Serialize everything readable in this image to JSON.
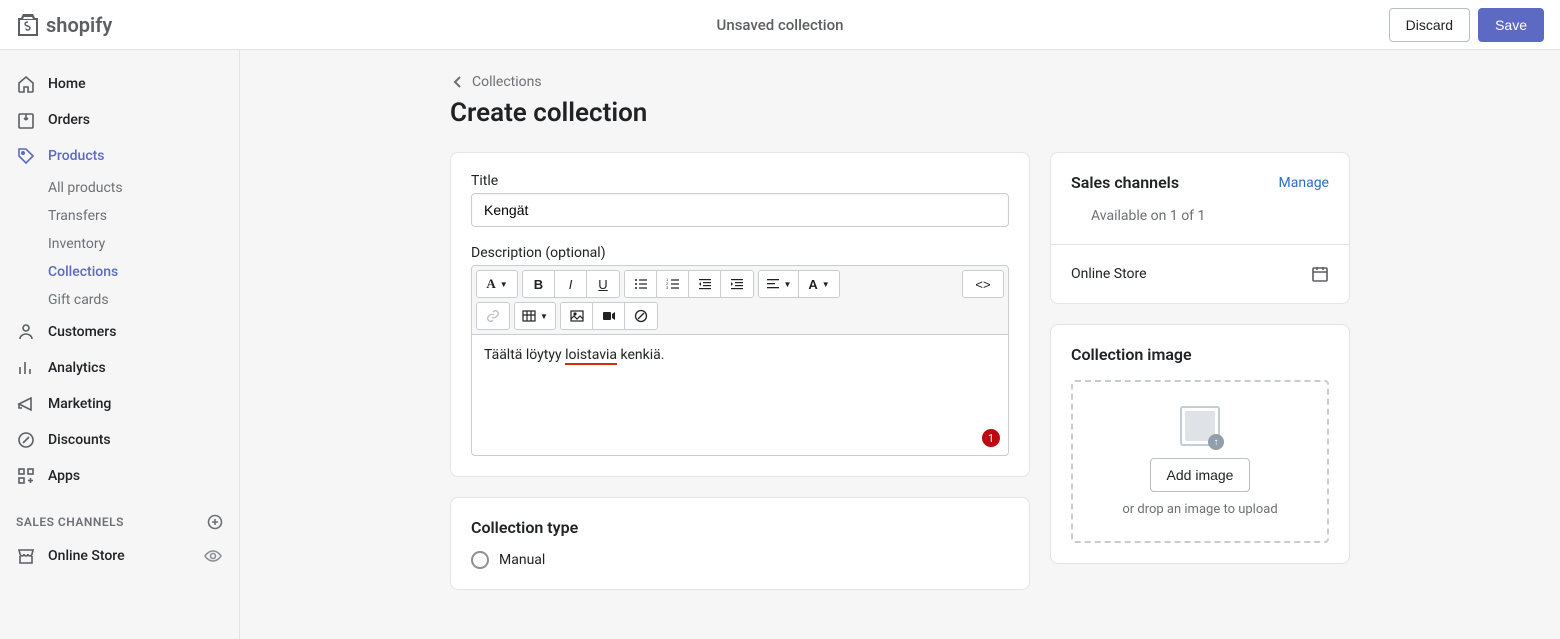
{
  "brand": "shopify",
  "topbar": {
    "title": "Unsaved collection",
    "discard": "Discard",
    "save": "Save"
  },
  "nav": {
    "home": "Home",
    "orders": "Orders",
    "products": "Products",
    "sub": {
      "all_products": "All products",
      "transfers": "Transfers",
      "inventory": "Inventory",
      "collections": "Collections",
      "gift_cards": "Gift cards"
    },
    "customers": "Customers",
    "analytics": "Analytics",
    "marketing": "Marketing",
    "discounts": "Discounts",
    "apps": "Apps",
    "sales_channels_header": "SALES CHANNELS",
    "online_store": "Online Store"
  },
  "breadcrumb": "Collections",
  "page_title": "Create collection",
  "form": {
    "title_label": "Title",
    "title_value": "Kengät",
    "description_label": "Description (optional)",
    "description_prefix": "Täältä löytyy ",
    "description_spell": "loistavia",
    "description_suffix": " kenkiä.",
    "badge_count": "1"
  },
  "collection_type": {
    "heading": "Collection type",
    "option_manual": "Manual"
  },
  "sales_channels": {
    "title": "Sales channels",
    "manage": "Manage",
    "availability": "Available on 1 of 1",
    "online_store": "Online Store"
  },
  "collection_image": {
    "title": "Collection image",
    "add_button": "Add image",
    "hint": "or drop an image to upload"
  },
  "rte": {
    "code_icon": "<>"
  }
}
